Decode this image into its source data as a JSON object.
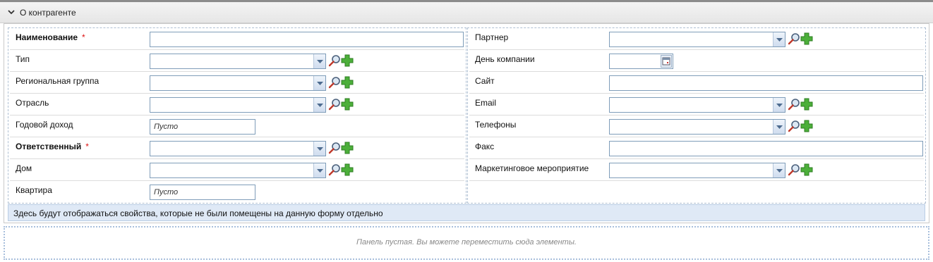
{
  "section": {
    "title": "О контрагенте"
  },
  "left_fields": [
    {
      "label": "Наименование",
      "required": "*"
    },
    {
      "label": "Тип"
    },
    {
      "label": "Региональная группа"
    },
    {
      "label": "Отрасль"
    },
    {
      "label": "Годовой доход",
      "placeholder": "Пусто"
    },
    {
      "label": "Ответственный",
      "required": "*"
    },
    {
      "label": "Дом"
    },
    {
      "label": "Квартира",
      "placeholder": "Пусто"
    }
  ],
  "right_fields": [
    {
      "label": "Партнер"
    },
    {
      "label": "День компании"
    },
    {
      "label": "Сайт"
    },
    {
      "label": "Email"
    },
    {
      "label": "Телефоны"
    },
    {
      "label": "Факс"
    },
    {
      "label": "Маркетинговое мероприятие"
    }
  ],
  "info_text": "Здесь будут отображаться свойства, которые не были помещены на данную форму отдельно",
  "empty_panel_text": "Панель пустая. Вы можете переместить сюда элементы.",
  "icons": {
    "lookup": "magnifier-icon",
    "add": "plus-icon",
    "dropdown": "chevron-down-icon",
    "calendar": "calendar-icon",
    "collapse": "chevron-down-icon"
  },
  "colors": {
    "add_icon": "#4caf3a",
    "required": "#dd1111",
    "info_bg": "#dfe9f6",
    "input_border": "#7f9db9"
  }
}
